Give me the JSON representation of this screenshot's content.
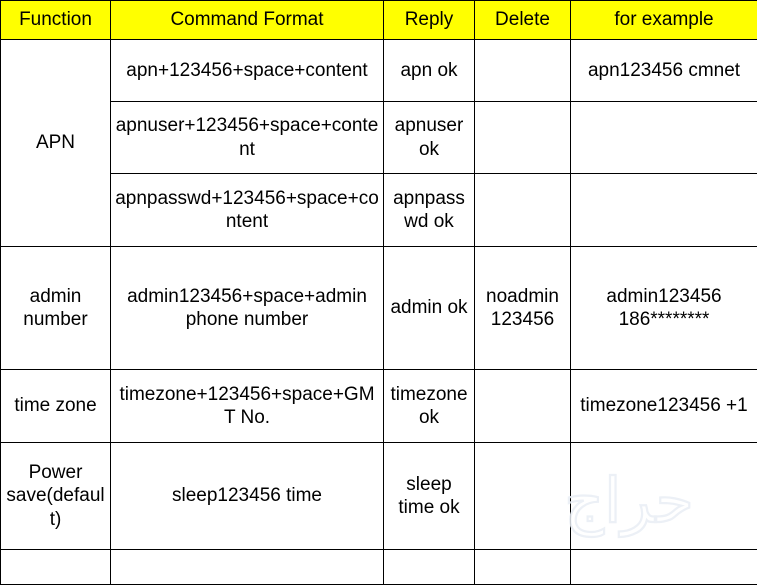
{
  "table": {
    "headers": [
      {
        "label": "Function",
        "key": "function"
      },
      {
        "label": "Command Format",
        "key": "command_format"
      },
      {
        "label": "Reply",
        "key": "reply"
      },
      {
        "label": "Delete",
        "key": "delete"
      },
      {
        "label": "for example",
        "key": "for_example"
      }
    ],
    "rows": [
      {
        "function": "APN",
        "function_rowspan": 3,
        "command_format": "apn+123456+space+content",
        "reply": "apn ok",
        "delete": "",
        "for_example": "apn123456 cmnet"
      },
      {
        "function": null,
        "command_format": "apnuser+123456+space+content",
        "reply": "apnuser ok",
        "delete": "",
        "for_example": ""
      },
      {
        "function": null,
        "command_format": "apnpasswd+123456+space+content",
        "reply": "apnpasswd ok",
        "delete": "",
        "for_example": ""
      },
      {
        "function": "admin number",
        "command_format": "admin123456+space+admin phone number",
        "reply": "admin ok",
        "delete": "noadmin 123456",
        "for_example": "admin123456 186********"
      },
      {
        "function": "time zone",
        "command_format": "timezone+123456+space+GMT No.",
        "reply": "timezone ok",
        "delete": "",
        "for_example": "timezone123456 +1"
      },
      {
        "function": "Power save(default)",
        "command_format": "sleep123456 time",
        "reply": "sleep time ok",
        "delete": "",
        "for_example": ""
      },
      {
        "function": "",
        "command_format": "",
        "reply": "",
        "delete": "",
        "for_example": ""
      }
    ]
  },
  "watermark": {
    "text": "حراج",
    "color": "#e9eef5"
  },
  "colors": {
    "header_background": "#ffff00",
    "function_column_background": "#dce6f1",
    "cell_background": "#ffffff",
    "border": "#000000",
    "text": "#000000"
  }
}
